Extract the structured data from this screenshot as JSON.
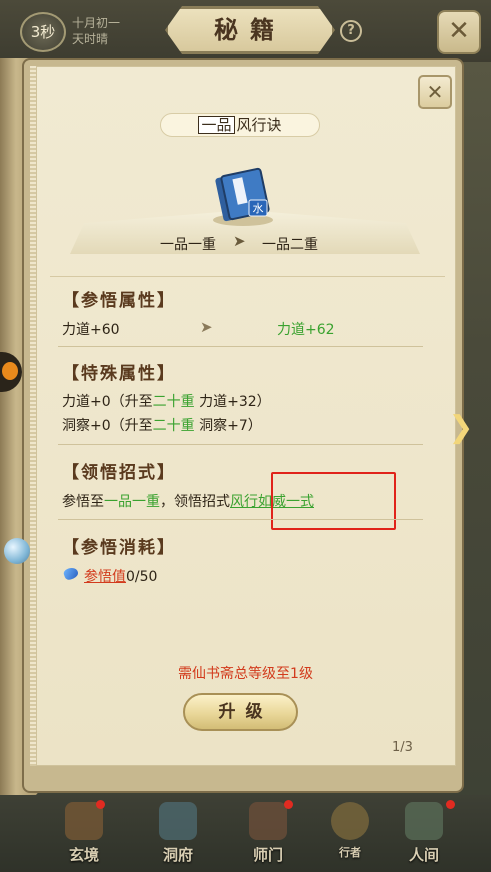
{
  "header": {
    "timer": "3秒",
    "date_line1": "十月初一",
    "date_line2": "天时晴",
    "title": "秘籍",
    "help": "?",
    "close": "✕"
  },
  "skill": {
    "grade_label": "一品",
    "name": "风行诀",
    "icon_text": "水",
    "current_grade": "一品一重",
    "next_grade": "一品二重",
    "arrow": "➤"
  },
  "sections": {
    "insight_attr": {
      "title": "【参悟属性】",
      "current": "力道+60",
      "arrow": "➤",
      "next": "力道+62"
    },
    "special_attr": {
      "title": "【特殊属性】",
      "rows": [
        {
          "prefix": "力道+0（升至",
          "level": "二十重",
          "suffix": " 力道+32）"
        },
        {
          "prefix": "洞察+0（升至",
          "level": "二十重",
          "suffix": " 洞察+7）"
        }
      ]
    },
    "moves": {
      "title": "【领悟招式】",
      "prefix": "参悟至",
      "grade": "一品一重",
      "middle": "，领悟招式",
      "move_name": "风行如威一式"
    },
    "cost": {
      "title": "【参悟消耗】",
      "item": "参悟值",
      "amount": "0/50"
    }
  },
  "requirement": "需仙书斋总等级至1级",
  "upgrade_button": "升级",
  "page_indicator": "1/3",
  "bottom_nav": [
    {
      "label": "玄境"
    },
    {
      "label": "洞府"
    },
    {
      "label": "师门"
    },
    {
      "label": "行者"
    },
    {
      "label": "人间"
    }
  ],
  "colors": {
    "highlight_box": "#e0231a",
    "green": "#3aa22f",
    "red_text": "#d23a1c",
    "page_bg": "#f1ead2"
  }
}
